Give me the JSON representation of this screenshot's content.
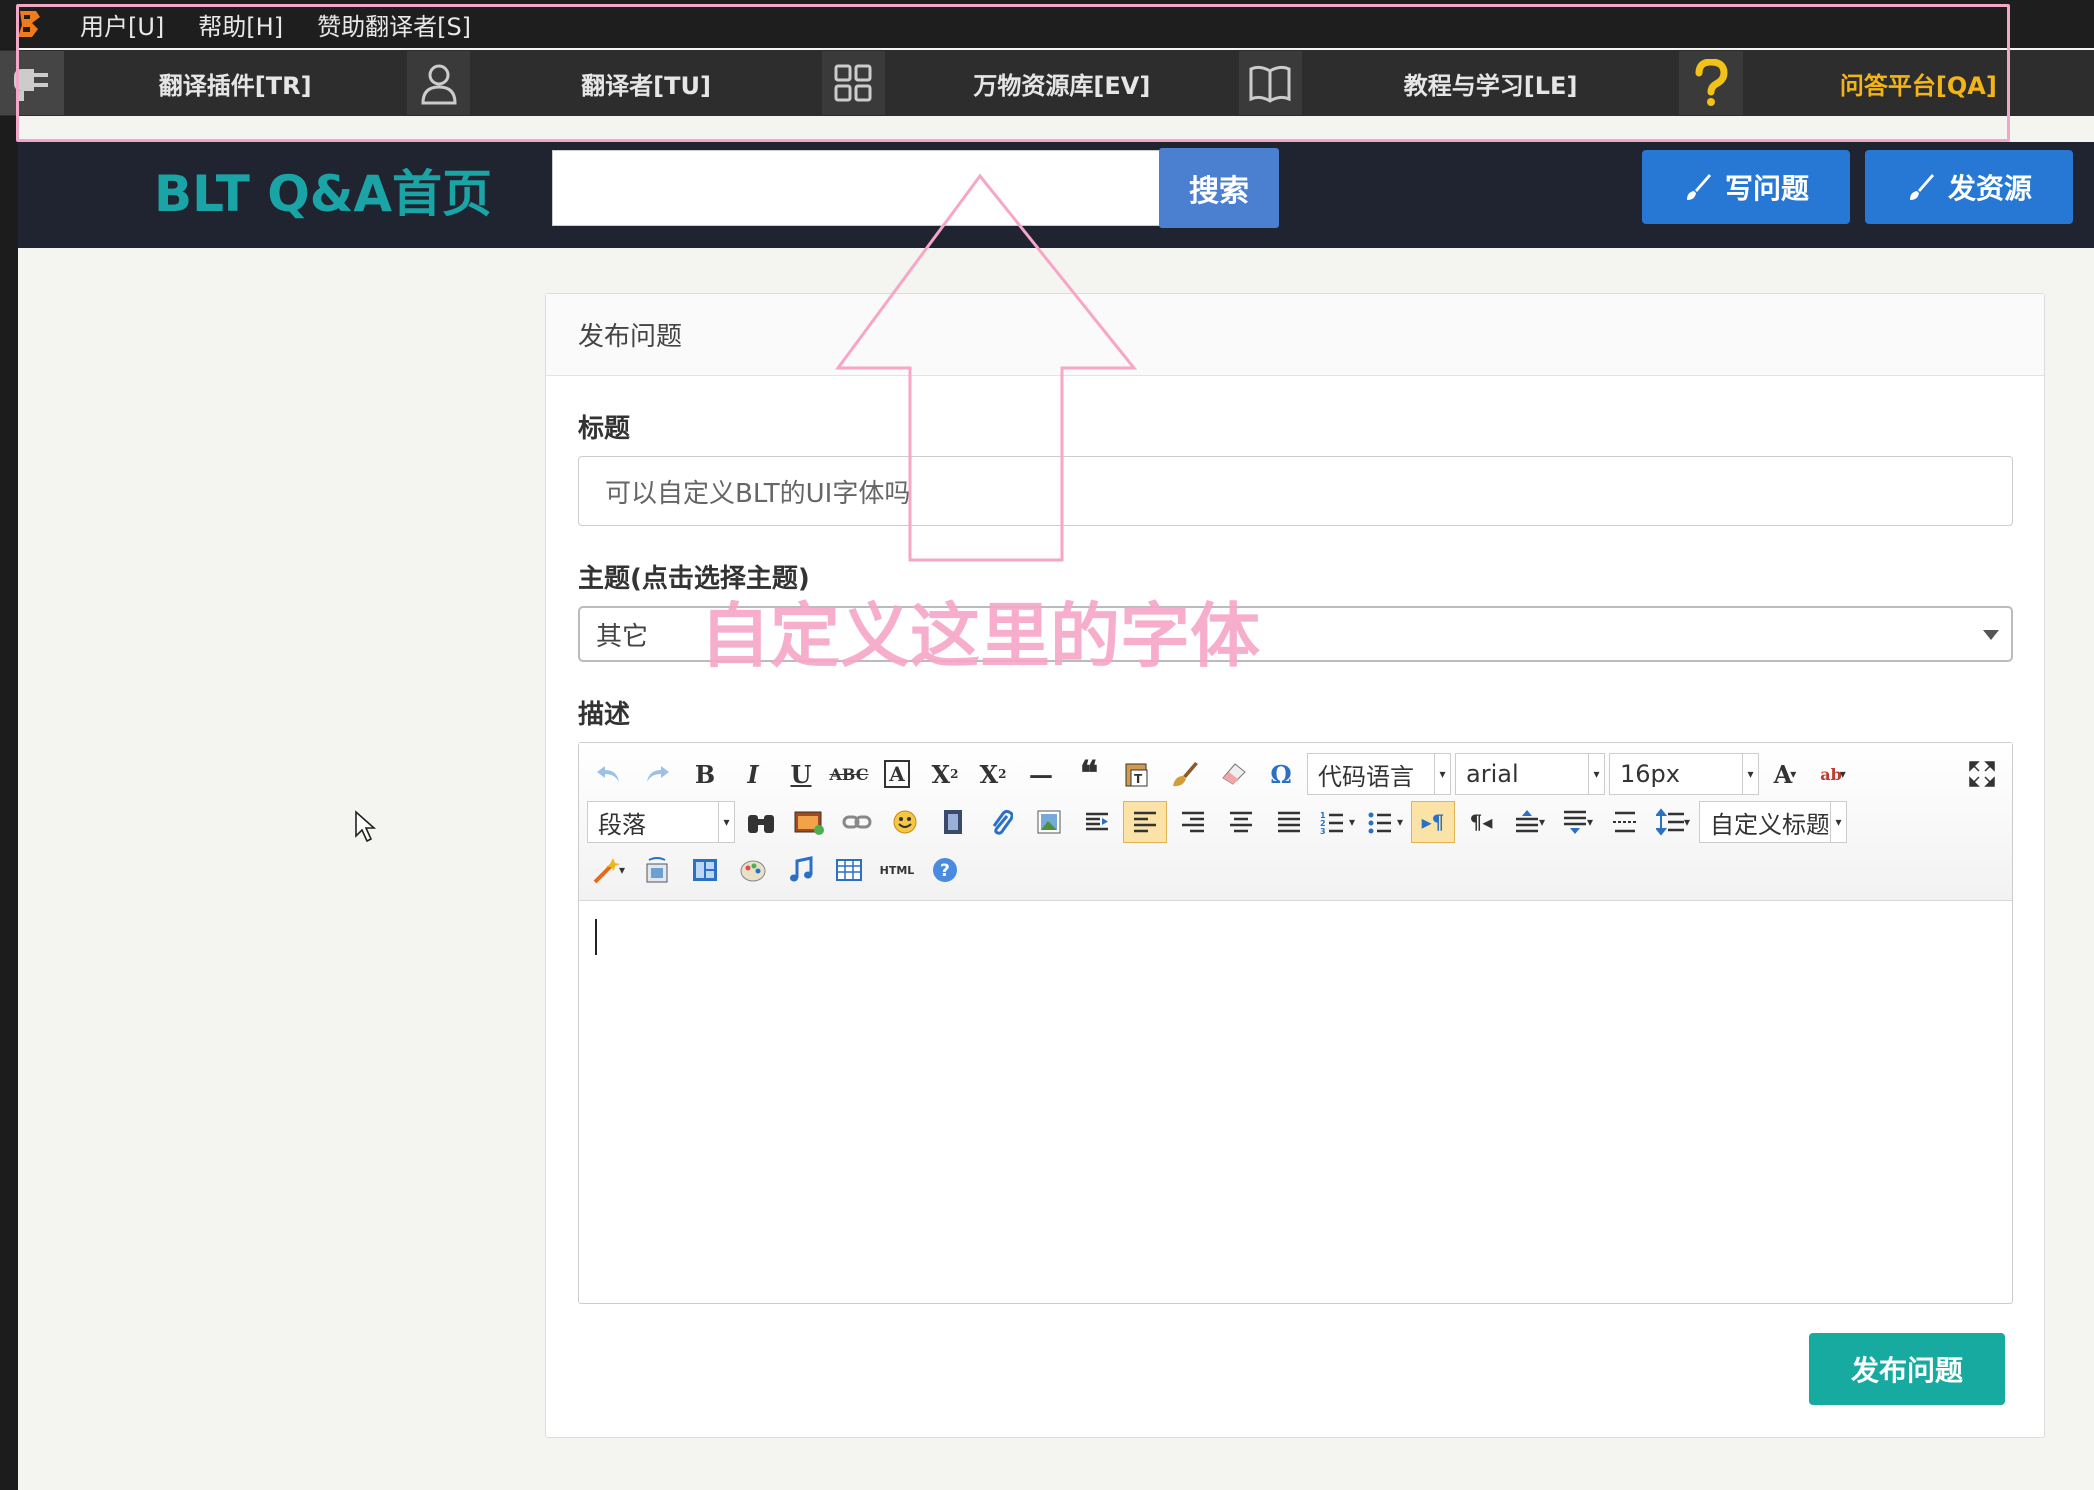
{
  "menu": {
    "items": [
      "用户[U]",
      "帮助[H]",
      "赞助翻译者[S]"
    ]
  },
  "nav": {
    "items": [
      {
        "label": "翻译插件[TR]",
        "icon": "plug-icon"
      },
      {
        "label": "翻译者[TU]",
        "icon": "user-icon"
      },
      {
        "label": "万物资源库[EV]",
        "icon": "grid-icon"
      },
      {
        "label": "教程与学习[LE]",
        "icon": "book-icon"
      },
      {
        "label": "问答平台[QA]",
        "icon": "question-icon",
        "active": true
      }
    ]
  },
  "header": {
    "title": "BLT Q&A首页",
    "search_value": "",
    "search_label": "搜索",
    "write_question_label": "写问题",
    "post_resource_label": "发资源"
  },
  "form": {
    "panel_title": "发布问题",
    "title_label": "标题",
    "title_value": "可以自定义BLT的UI字体吗",
    "topic_label": "主题(点击选择主题)",
    "topic_value": "其它",
    "desc_label": "描述",
    "submit_label": "发布问题"
  },
  "editor": {
    "code_lang": "代码语言",
    "font_family": "arial",
    "font_size": "16px",
    "paragraph": "段落",
    "custom_title": "自定义标题"
  },
  "annotation": {
    "text": "自定义这里的字体"
  },
  "colors": {
    "accent_teal": "#1aa4a6",
    "nav_active": "#f3b418",
    "highlight_pink": "#f3a7c6",
    "button_blue": "#2778d4"
  }
}
